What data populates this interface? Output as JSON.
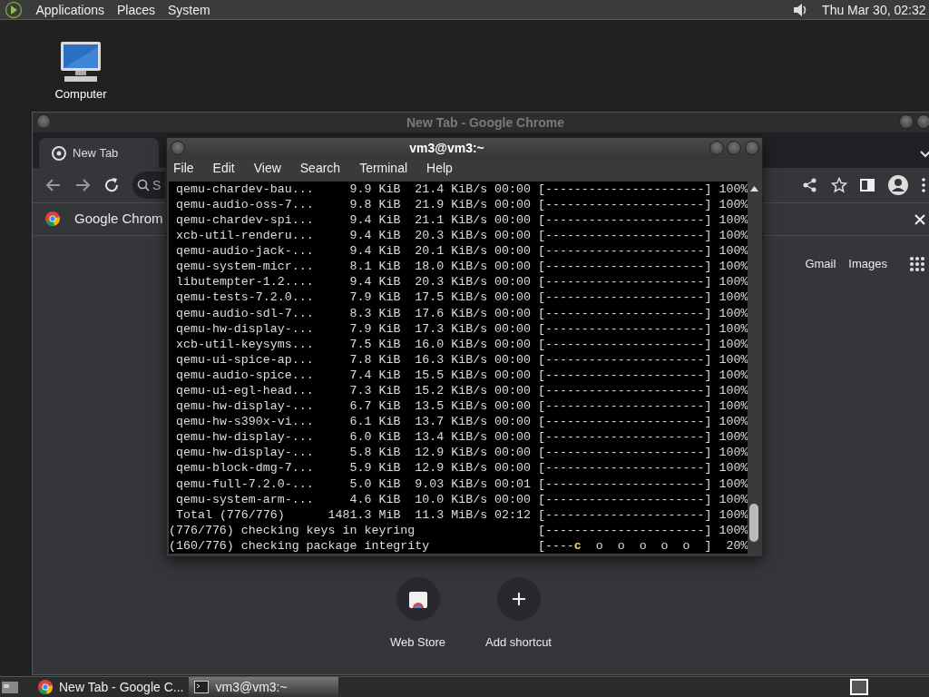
{
  "top_panel": {
    "menus": [
      "Applications",
      "Places",
      "System"
    ],
    "clock": "Thu Mar 30, 02:32"
  },
  "desktop_icons": [
    {
      "label": "Computer"
    }
  ],
  "chrome": {
    "title": "New Tab - Google Chrome",
    "tabs": [
      {
        "label": "New Tab",
        "selected": true
      }
    ],
    "omnibox_text": "S",
    "infobar_text": "Google Chrom",
    "top_links": [
      "Gmail",
      "Images"
    ],
    "shortcuts": [
      {
        "label": "Web Store",
        "kind": "store"
      },
      {
        "label": "Add shortcut",
        "kind": "add"
      }
    ]
  },
  "terminal": {
    "title": "vm3@vm3:~",
    "menu": [
      "File",
      "Edit",
      "View",
      "Search",
      "Terminal",
      "Help"
    ],
    "lines": [
      {
        "kind": "package",
        "text": "qemu-chardev-bau...     9.9 KiB  21.4 KiB/s 00:00 [----------------------] 100%"
      },
      {
        "kind": "package",
        "text": "qemu-audio-oss-7...     9.8 KiB  21.9 KiB/s 00:00 [----------------------] 100%"
      },
      {
        "kind": "package",
        "text": "qemu-chardev-spi...     9.4 KiB  21.1 KiB/s 00:00 [----------------------] 100%"
      },
      {
        "kind": "package",
        "text": "xcb-util-renderu...     9.4 KiB  20.3 KiB/s 00:00 [----------------------] 100%"
      },
      {
        "kind": "package",
        "text": "qemu-audio-jack-...     9.4 KiB  20.1 KiB/s 00:00 [----------------------] 100%"
      },
      {
        "kind": "package",
        "text": "qemu-system-micr...     8.1 KiB  18.0 KiB/s 00:00 [----------------------] 100%"
      },
      {
        "kind": "package",
        "text": "libutempter-1.2....     9.4 KiB  20.3 KiB/s 00:00 [----------------------] 100%"
      },
      {
        "kind": "package",
        "text": "qemu-tests-7.2.0...     7.9 KiB  17.5 KiB/s 00:00 [----------------------] 100%"
      },
      {
        "kind": "package",
        "text": "qemu-audio-sdl-7...     8.3 KiB  17.6 KiB/s 00:00 [----------------------] 100%"
      },
      {
        "kind": "package",
        "text": "qemu-hw-display-...     7.9 KiB  17.3 KiB/s 00:00 [----------------------] 100%"
      },
      {
        "kind": "package",
        "text": "xcb-util-keysyms...     7.5 KiB  16.0 KiB/s 00:00 [----------------------] 100%"
      },
      {
        "kind": "package",
        "text": "qemu-ui-spice-ap...     7.8 KiB  16.3 KiB/s 00:00 [----------------------] 100%"
      },
      {
        "kind": "package",
        "text": "qemu-audio-spice...     7.4 KiB  15.5 KiB/s 00:00 [----------------------] 100%"
      },
      {
        "kind": "package",
        "text": "qemu-ui-egl-head...     7.3 KiB  15.2 KiB/s 00:00 [----------------------] 100%"
      },
      {
        "kind": "package",
        "text": "qemu-hw-display-...     6.7 KiB  13.5 KiB/s 00:00 [----------------------] 100%"
      },
      {
        "kind": "package",
        "text": "qemu-hw-s390x-vi...     6.1 KiB  13.7 KiB/s 00:00 [----------------------] 100%"
      },
      {
        "kind": "package",
        "text": "qemu-hw-display-...     6.0 KiB  13.4 KiB/s 00:00 [----------------------] 100%"
      },
      {
        "kind": "package",
        "text": "qemu-hw-display-...     5.8 KiB  12.9 KiB/s 00:00 [----------------------] 100%"
      },
      {
        "kind": "package",
        "text": "qemu-block-dmg-7...     5.9 KiB  12.9 KiB/s 00:00 [----------------------] 100%"
      },
      {
        "kind": "package",
        "text": "qemu-full-7.2.0-...     5.0 KiB  9.03 KiB/s 00:01 [----------------------] 100%"
      },
      {
        "kind": "package",
        "text": "qemu-system-arm-...     4.6 KiB  10.0 KiB/s 00:00 [----------------------] 100%"
      },
      {
        "kind": "package",
        "text": "Total (776/776)      1481.3 MiB  11.3 MiB/s 02:12 [----------------------] 100%"
      },
      {
        "kind": "status",
        "text": "(776/776) checking keys in keyring                 [----------------------] 100%"
      },
      {
        "kind": "status",
        "text": "(160/776) checking package integrity               [----",
        "cursor": "c",
        "rest": "  o  o  o  o  o  ]  20%"
      }
    ]
  },
  "taskbar": {
    "items": [
      {
        "kind": "browser",
        "label": "New Tab - Google C...",
        "selected": false
      },
      {
        "kind": "terminal",
        "label": "vm3@vm3:~",
        "selected": true
      }
    ]
  }
}
